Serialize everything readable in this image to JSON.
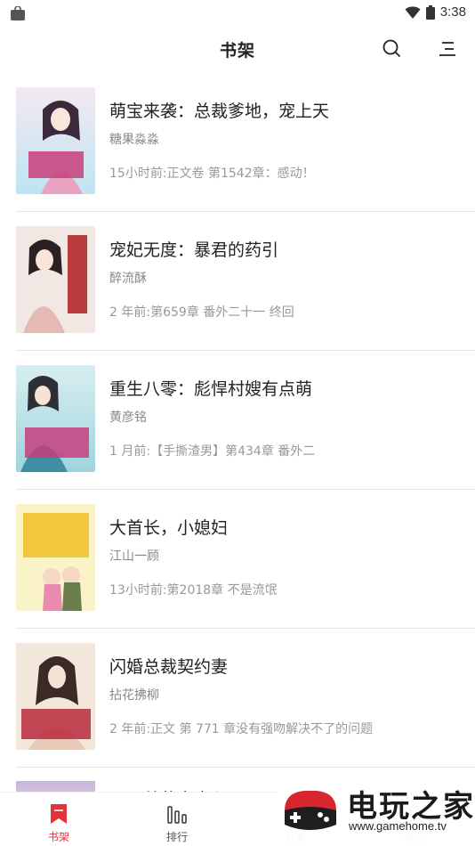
{
  "status_bar": {
    "time": "3:38"
  },
  "header": {
    "title": "书架"
  },
  "books": [
    {
      "title": "萌宝来袭：总裁爹地，宠上天",
      "author": "糖果淼淼",
      "update": "15小时前:正文卷 第1542章：感动！"
    },
    {
      "title": "宠妃无度：暴君的药引",
      "author": "醉流酥",
      "update": "2 年前:第659章 番外二十一 终回"
    },
    {
      "title": "重生八零：彪悍村嫂有点萌",
      "author": "黄彦铭",
      "update": "1 月前:【手撕渣男】第434章 番外二"
    },
    {
      "title": "大首长，小媳妇",
      "author": "江山一顾",
      "update": "13小时前:第2018章 不是流氓"
    },
    {
      "title": "闪婚总裁契约妻",
      "author": "拈花拂柳",
      "update": "2 年前:正文 第 771 章没有强吻解决不了的问题"
    }
  ],
  "partial_book": {
    "title": "双正总裁宝妻入局"
  },
  "tabs": [
    {
      "label": "书架",
      "icon": "bookmark-icon",
      "active": true
    },
    {
      "label": "排行",
      "icon": "ranking-icon",
      "active": false
    },
    {
      "label": "分类",
      "icon": "category-icon",
      "active": false
    },
    {
      "label": "我的",
      "icon": "profile-icon",
      "active": false
    }
  ],
  "watermark": {
    "name": "电玩之家",
    "url": "www.gamehome.tv"
  },
  "colors": {
    "accent": "#e2323a",
    "divider": "#e4e4e4"
  }
}
